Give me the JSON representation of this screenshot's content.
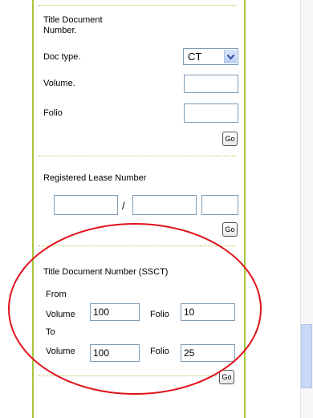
{
  "title_doc": {
    "heading": "Title Document\nNumber.",
    "doc_type_label": "Doc type.",
    "doc_type_value": "CT",
    "volume_label": "Volume.",
    "volume_value": "",
    "folio_label": "Folio",
    "folio_value": "",
    "go_label": "Go"
  },
  "lease": {
    "heading": "Registered Lease Number",
    "field1": "",
    "separator": "/",
    "field2": "",
    "field3": "",
    "go_label": "Go"
  },
  "ssct": {
    "heading": "Title Document Number (SSCT)",
    "from_label": "From",
    "from_volume_label": "Volume",
    "from_volume_value": "100",
    "from_folio_label": "Folio",
    "from_folio_value": "10",
    "to_label": "To",
    "to_volume_label": "Volume",
    "to_volume_value": "100",
    "to_folio_label": "Folio",
    "to_folio_value": "25",
    "go_label": "Go"
  },
  "colors": {
    "panel_border": "#a8c83a",
    "annotation": "#e0121b"
  },
  "icons": [
    "chevron-down-icon"
  ]
}
